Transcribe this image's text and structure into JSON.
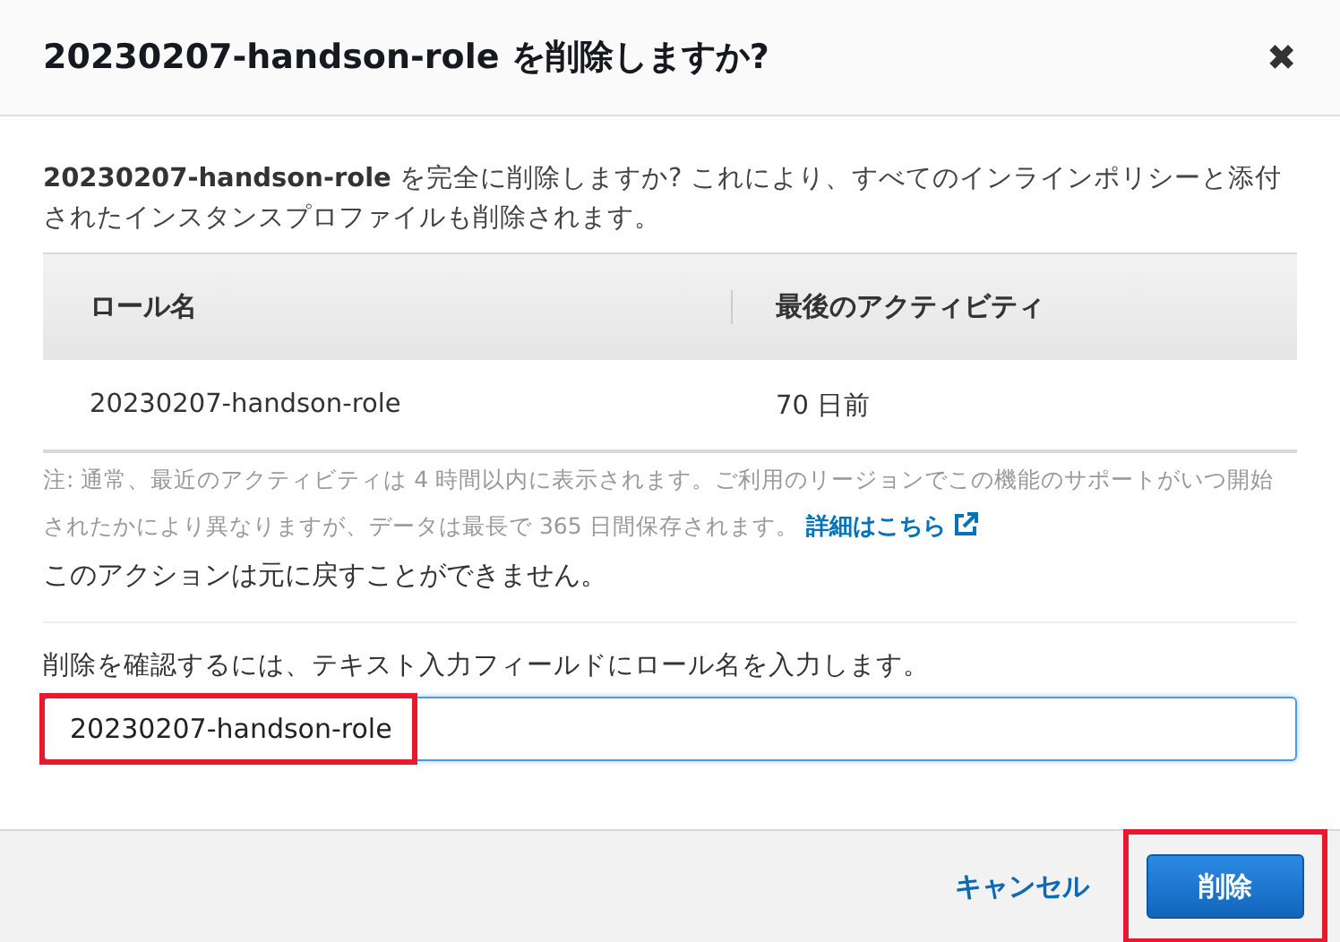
{
  "dialog": {
    "title": "20230207-handson-role を削除しますか?",
    "close": "✖"
  },
  "description": "**20230207-handson-role** を完全に削除しますか? これにより、すべてのインラインポリシーと添付されたインスタンスプロファイルも削除されます。",
  "table": {
    "columns": [
      "ロール名",
      "最後のアクティビティ"
    ],
    "rows": [
      [
        "20230207-handson-role",
        "70 日前"
      ]
    ]
  },
  "note": {
    "text": "注: 通常、最近のアクティビティは 4 時間以内に表示されます。ご利用のリージョンでこの機能のサポートがいつ開始されたかにより異なりますが、データは最長で 365 日間保存されます。",
    "link": "詳細はこちら"
  },
  "warning": "このアクションは元に戻すことができません。",
  "confirm": {
    "label": "削除を確認するには、テキスト入力フィールドにロール名を入力します。",
    "value": "20230207-handson-role",
    "highlighted": true
  },
  "buttons": [
    {
      "kind": "link",
      "label": "キャンセル",
      "highlighted": false
    },
    {
      "kind": "primary",
      "label": "削除",
      "highlighted": true
    }
  ]
}
